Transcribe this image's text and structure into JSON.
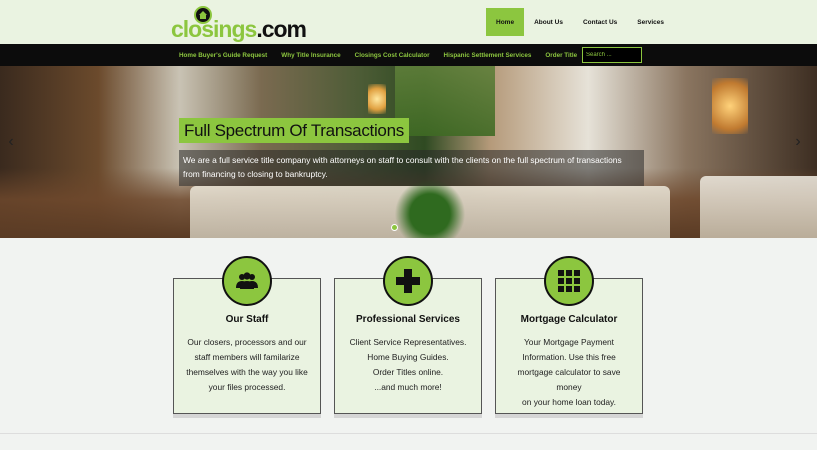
{
  "logo": {
    "part1": "closings",
    "part2": ".com"
  },
  "nav": [
    {
      "label": "Home",
      "active": true
    },
    {
      "label": "About Us",
      "active": false
    },
    {
      "label": "Contact Us",
      "active": false
    },
    {
      "label": "Services",
      "active": false
    }
  ],
  "subnav": [
    "Home Buyer's Guide Request",
    "Why Title Insurance",
    "Closings Cost Calculator",
    "Hispanic Settlement Services",
    "Order Title"
  ],
  "search": {
    "placeholder": "Search ..."
  },
  "hero": {
    "title": "Full Spectrum Of Transactions",
    "description": "We are a full service title company with attorneys on staff to consult with the clients on the full spectrum of transactions from financing to closing to bankruptcy."
  },
  "cards": [
    {
      "icon": "group-icon",
      "title": "Our Staff",
      "lines": [
        "Our closers, processors and our",
        "staff members will familarize",
        "themselves with the way you like",
        "your files processed."
      ]
    },
    {
      "icon": "plus-icon",
      "title": "Professional Services",
      "lines": [
        "Client Service Representatives.",
        "Home Buying Guides.",
        "Order Titles online.",
        "...and much more!"
      ]
    },
    {
      "icon": "calculator-grid-icon",
      "title": "Mortgage Calculator",
      "lines": [
        "Your Mortgage Payment",
        "Information. Use this free",
        "mortgage calculator to save money",
        "on your home loan today."
      ]
    }
  ],
  "colors": {
    "accent": "#8cc63f",
    "dark": "#0c0c0c",
    "header_bg": "#eaf3e1"
  }
}
